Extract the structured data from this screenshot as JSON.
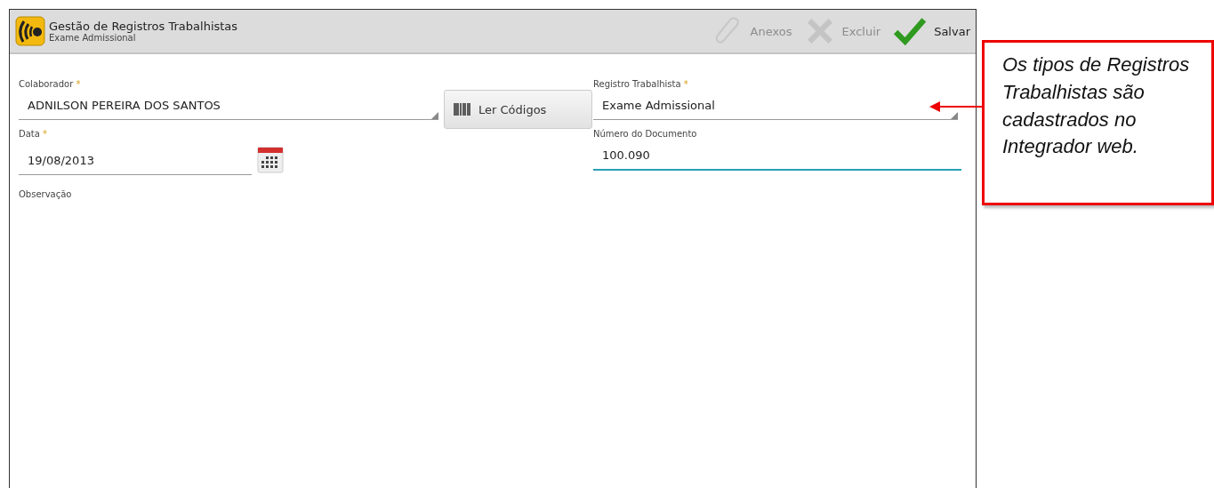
{
  "window": {
    "title": "Gestão de Registros Trabalhistas",
    "subtitle": "Exame Admissional"
  },
  "actions": [
    {
      "label": "Anexos",
      "kind": "attach",
      "disabled": true
    },
    {
      "label": "Excluir",
      "kind": "delete",
      "disabled": true
    },
    {
      "label": "Salvar",
      "kind": "save",
      "disabled": false
    }
  ],
  "required_marker": "*",
  "fields": {
    "colaborador": {
      "label": "Colaborador",
      "required": true,
      "value": "ADNILSON PEREIRA DOS SANTOS",
      "focused": false
    },
    "scan_button": "Ler Códigos",
    "registro": {
      "label": "Registro Trabalhista",
      "required": true,
      "value": "Exame Admissional",
      "focused": false
    },
    "data": {
      "label": "Data",
      "required": true,
      "value": "19/08/2013",
      "focused": false
    },
    "numero": {
      "label": "Número do Documento",
      "required": false,
      "value": "100.090",
      "focused": true
    },
    "observacao": {
      "label": "Observação"
    }
  },
  "callout": {
    "text": "Os tipos de Registros Trabalhistas são cadastrados no Integrador web."
  }
}
